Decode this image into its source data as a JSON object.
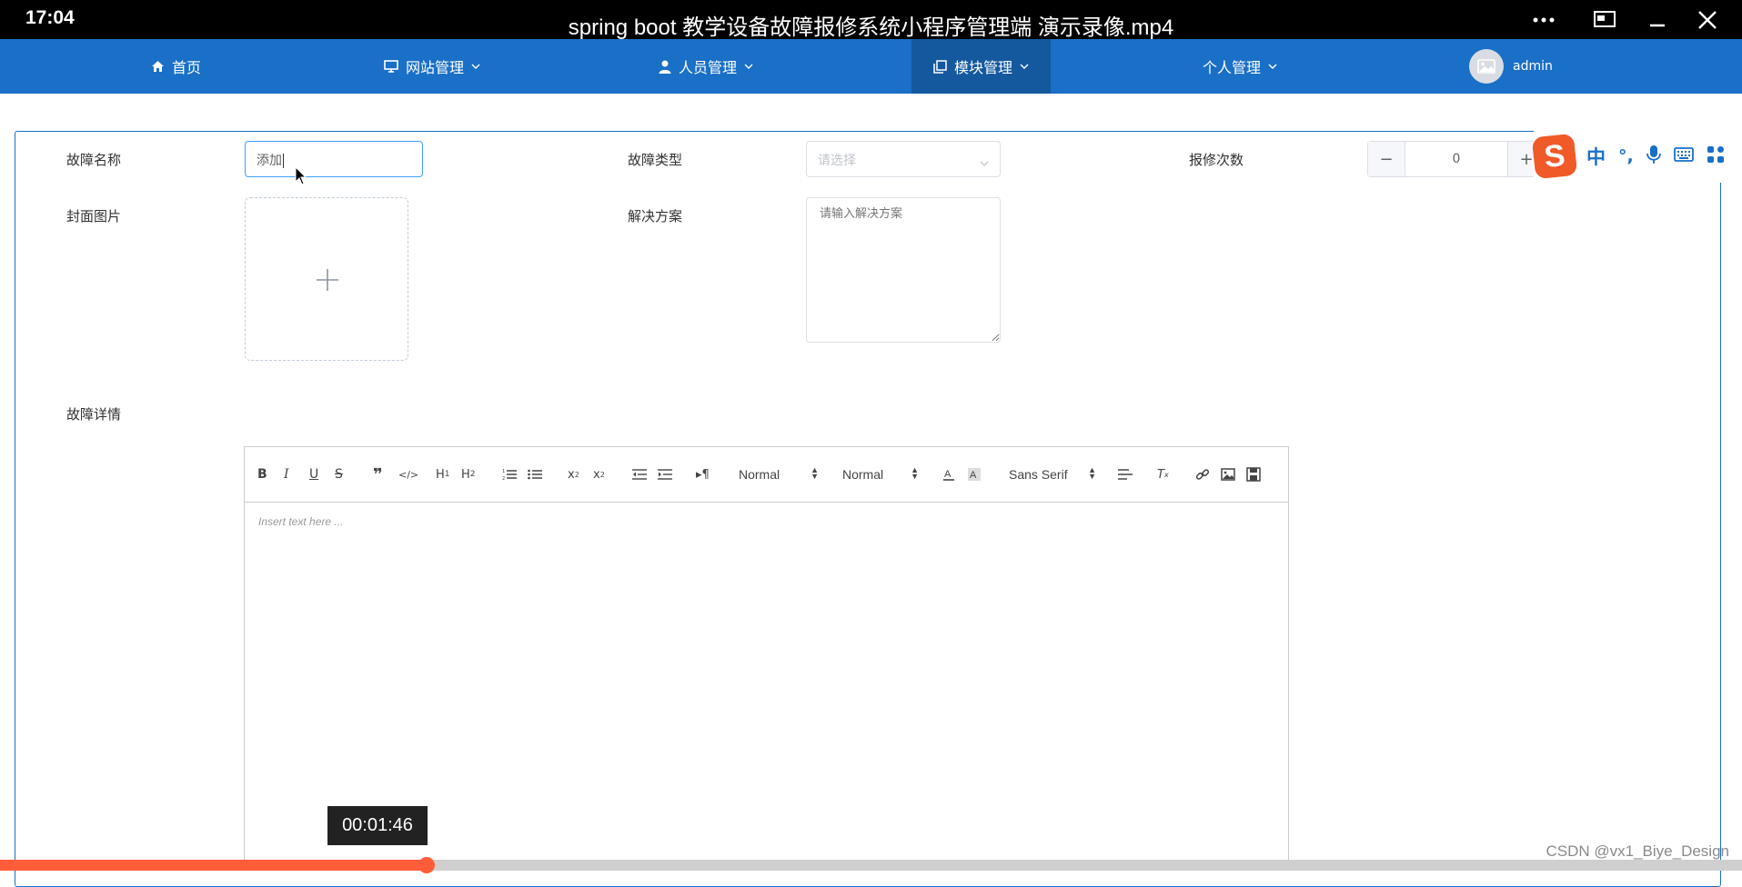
{
  "player": {
    "time": "17:04",
    "title": "spring boot 教学设备故障报修系统小程序管理端 演示录像.mp4",
    "controls": [
      "more-icon",
      "pip-icon",
      "minimize-icon",
      "close-icon"
    ],
    "timecode": "00:01:46",
    "progress_fraction": 0.245
  },
  "nav": {
    "items": [
      {
        "label": "首页",
        "icon": "home-icon",
        "dropdown": false,
        "active": false
      },
      {
        "label": "网站管理",
        "icon": "monitor-icon",
        "dropdown": true,
        "active": false
      },
      {
        "label": "人员管理",
        "icon": "user-icon",
        "dropdown": true,
        "active": false
      },
      {
        "label": "模块管理",
        "icon": "copy-icon",
        "dropdown": true,
        "active": true
      },
      {
        "label": "个人管理",
        "icon": "",
        "dropdown": true,
        "active": false
      }
    ],
    "user": {
      "name": "admin",
      "avatar_icon": "image-icon"
    }
  },
  "form": {
    "fault_name": {
      "label": "故障名称",
      "value": "添加"
    },
    "fault_type": {
      "label": "故障类型",
      "placeholder": "请选择"
    },
    "repair_count": {
      "label": "报修次数",
      "value": "0",
      "minus": "−",
      "plus": "+"
    },
    "cover_image": {
      "label": "封面图片",
      "icon": "plus-icon"
    },
    "solution": {
      "label": "解决方案",
      "placeholder": "请输入解决方案"
    },
    "fault_detail": {
      "label": "故障详情"
    }
  },
  "editor": {
    "header_select": "Normal",
    "size_select": "Normal",
    "font_select": "Sans Serif",
    "placeholder": "Insert text here ..."
  },
  "ime": {
    "brand": "S",
    "mode": "中",
    "punct": "°,"
  },
  "watermark": "CSDN @vx1_Biye_Design",
  "colors": {
    "nav": "#1a6fc6",
    "nav_active": "#14589e",
    "progress": "#ff5c39"
  }
}
